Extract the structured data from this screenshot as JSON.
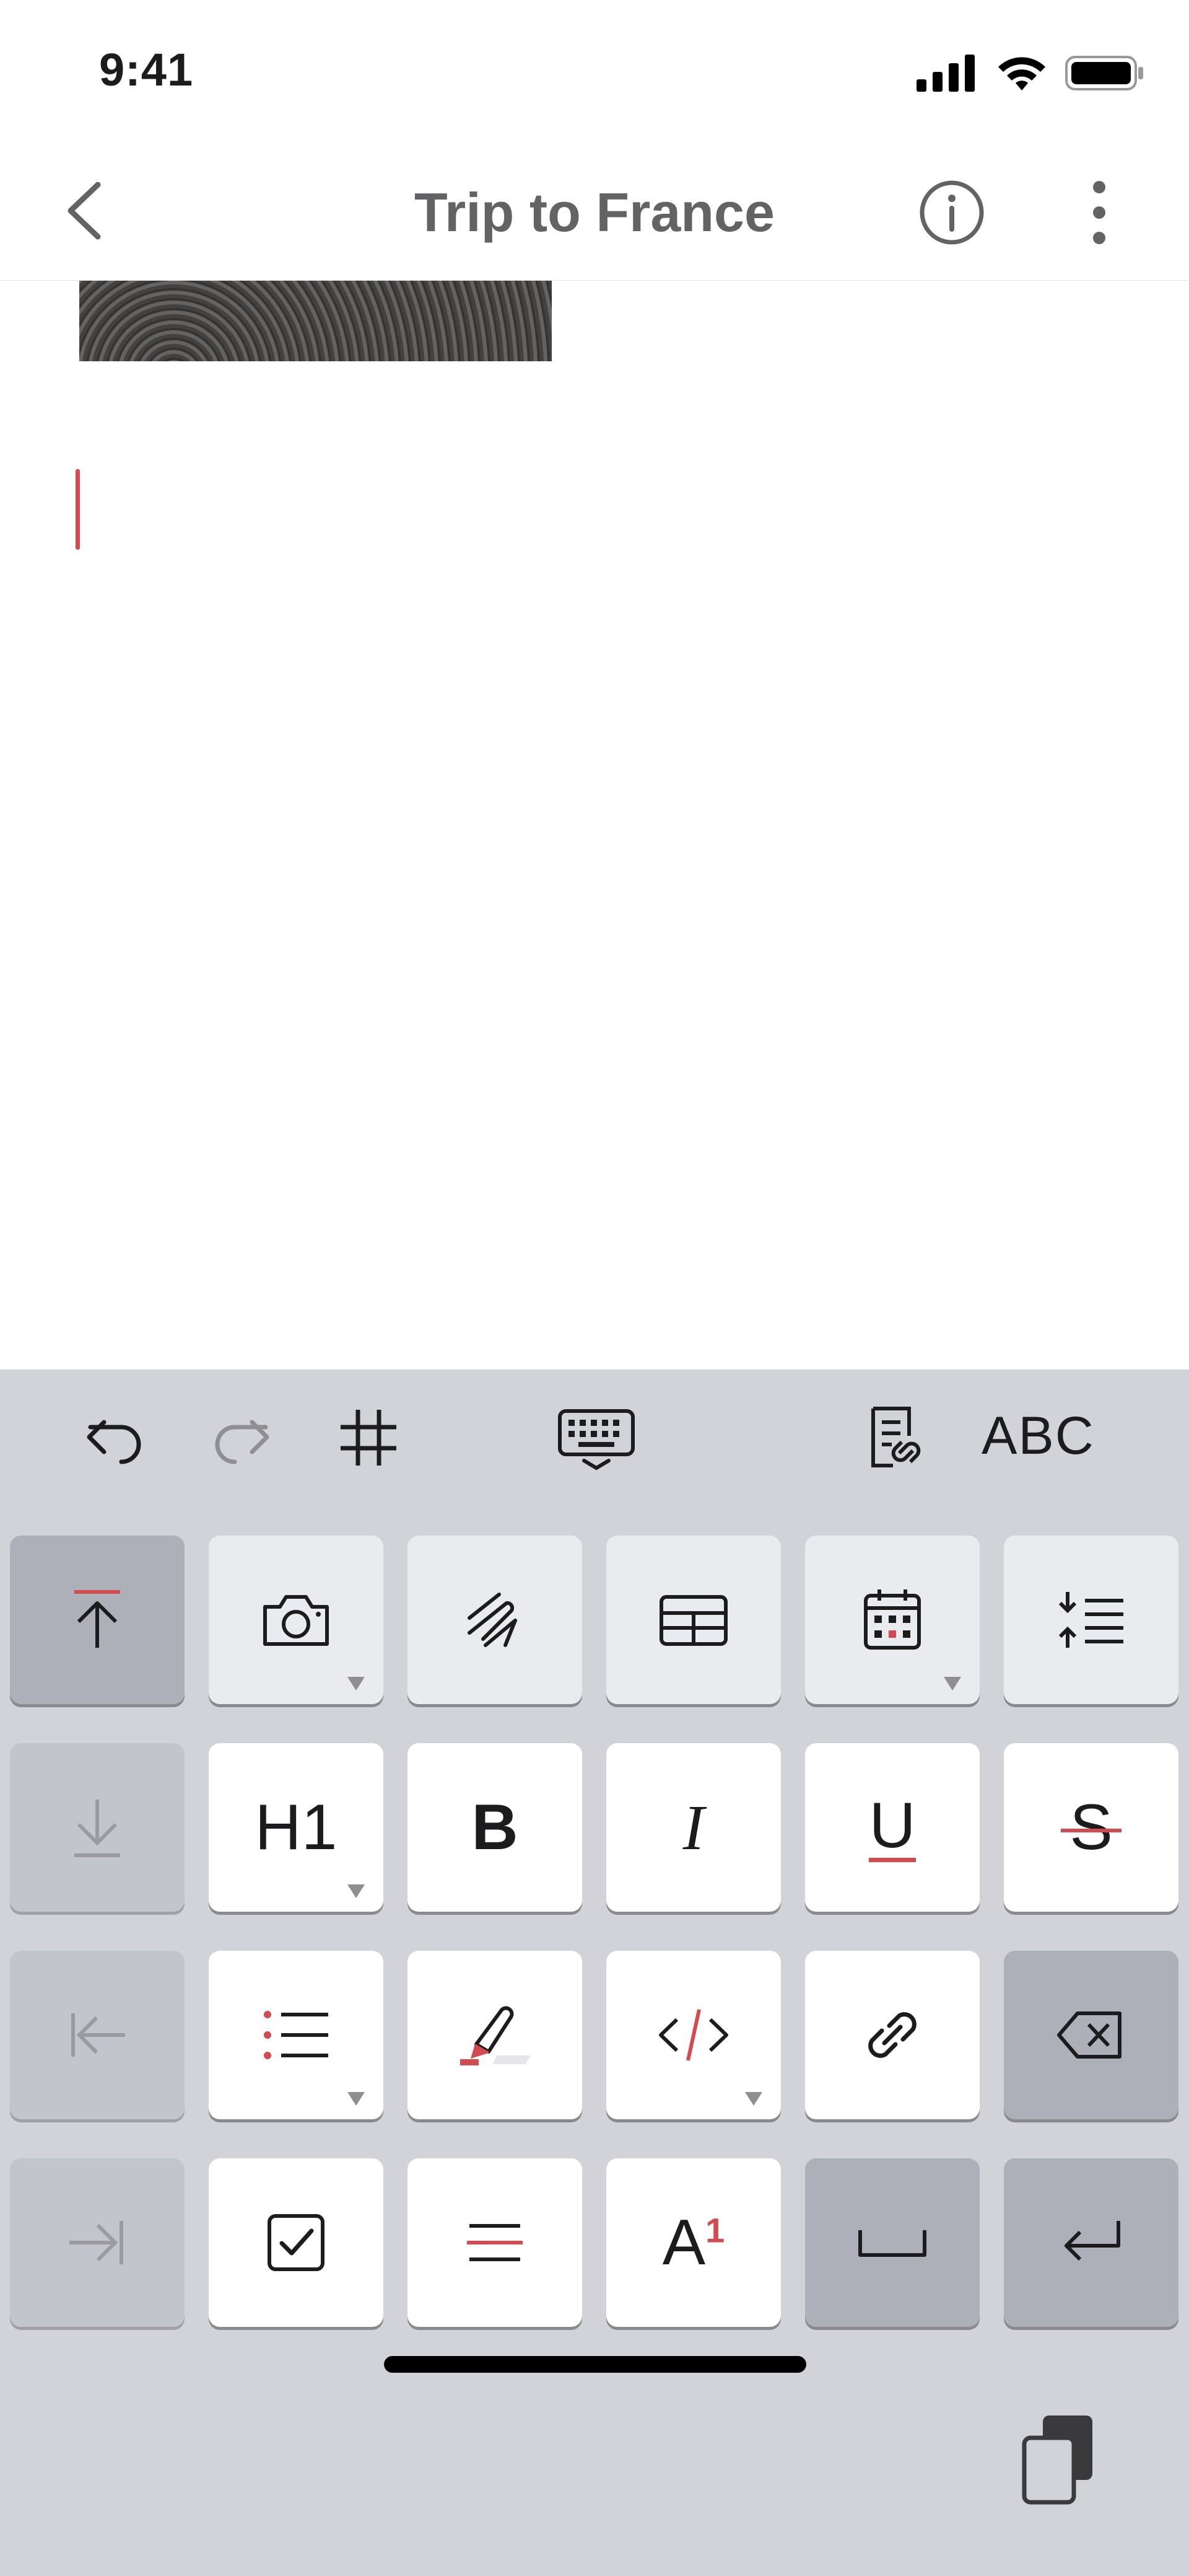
{
  "status_bar": {
    "time": "9:41"
  },
  "nav": {
    "title": "Trip to France"
  },
  "toolbar": {
    "abc_label": "ABC",
    "icons": [
      "undo-icon",
      "redo-icon",
      "tag-icon",
      "keyboard-hide-icon",
      "note-link-icon"
    ]
  },
  "keys": {
    "row1": [
      "move-up-icon",
      "camera-icon",
      "scribble-icon",
      "table-icon",
      "calendar-icon",
      "indent-lines-icon"
    ],
    "heading": "H1",
    "bold": "B",
    "italic": "I",
    "underline": "U",
    "strike": "S",
    "superscript_base": "A",
    "superscript_sup": "1"
  },
  "colors": {
    "accent": "#d24b50",
    "keyboard_bg": "#d1d3d9",
    "title": "#636366"
  }
}
